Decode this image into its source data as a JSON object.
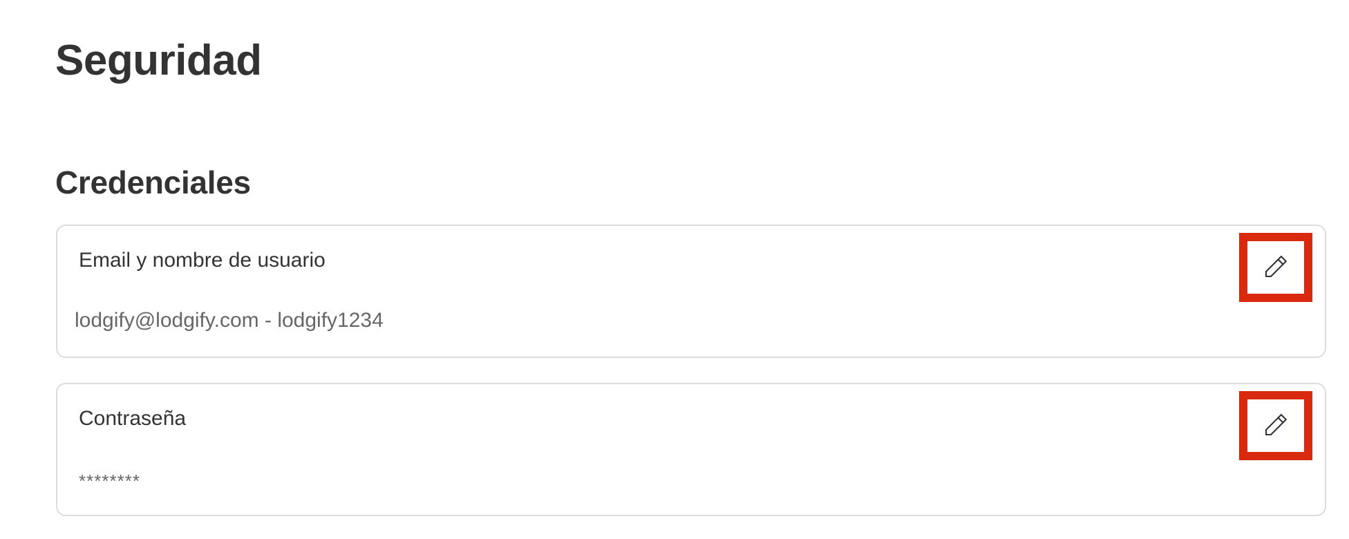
{
  "page": {
    "title": "Seguridad"
  },
  "section": {
    "title": "Credenciales"
  },
  "cards": [
    {
      "label": "Email y nombre de usuario",
      "value": "lodgify@lodgify.com - lodgify1234",
      "action_icon": "pencil-icon"
    },
    {
      "label": "Contraseña",
      "value": "********",
      "action_icon": "pencil-icon"
    }
  ],
  "colors": {
    "text_primary": "#333333",
    "text_secondary": "#666666",
    "border": "#dddddd",
    "highlight": "#d9290f"
  }
}
